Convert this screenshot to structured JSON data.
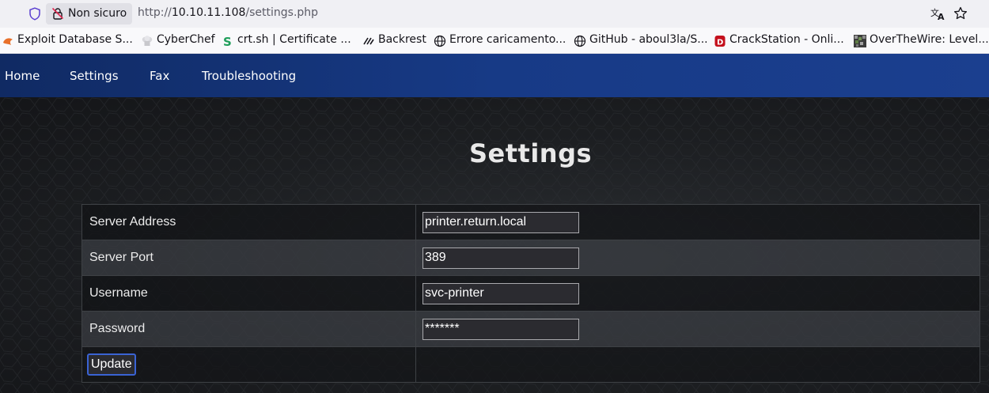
{
  "browser": {
    "security_label": "Non sicuro",
    "url_prefix": "http://",
    "url_host": "10.10.11.108",
    "url_path": "/settings.php"
  },
  "bookmarks": [
    {
      "label": "Exploit Database S...",
      "icon": "exploit-db-icon"
    },
    {
      "label": "CyberChef",
      "icon": "chef-hat-icon"
    },
    {
      "label": "crt.sh | Certificate ...",
      "icon": "crtsh-icon"
    },
    {
      "label": "Backrest",
      "icon": "backrest-icon"
    },
    {
      "label": "Errore caricamento...",
      "icon": "globe-icon"
    },
    {
      "label": "GitHub - aboul3la/S...",
      "icon": "globe-icon"
    },
    {
      "label": "CrackStation - Onli...",
      "icon": "crackstation-icon"
    },
    {
      "label": "OverTheWire: Level...",
      "icon": "overthewire-icon"
    }
  ],
  "nav": {
    "home": "Home",
    "settings": "Settings",
    "fax": "Fax",
    "troubleshooting": "Troubleshooting"
  },
  "page_title": "Settings",
  "form": {
    "rows": [
      {
        "label": "Server Address",
        "value": "printer.return.local"
      },
      {
        "label": "Server Port",
        "value": "389"
      },
      {
        "label": "Username",
        "value": "svc-printer"
      },
      {
        "label": "Password",
        "value": "*******"
      }
    ],
    "update_label": "Update"
  },
  "colors": {
    "nav_bar": "#173a86",
    "page_background": "#1c1e21",
    "button_focus_ring": "#3a63d4"
  }
}
